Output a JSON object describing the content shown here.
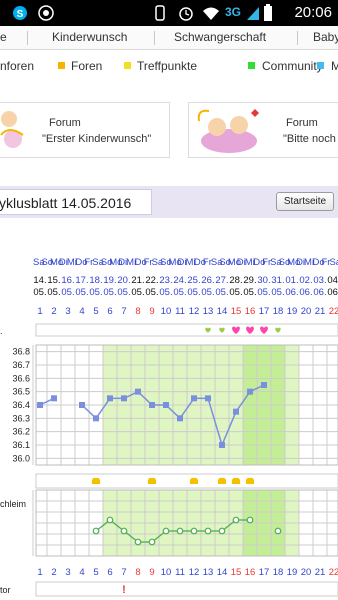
{
  "statusbar": {
    "time": "20:06",
    "network": "3G",
    "icons": [
      "skype-icon",
      "whatsapp-icon",
      "rotation-icon",
      "alarm-icon",
      "wifi-icon",
      "signal-icon",
      "battery-icon"
    ]
  },
  "nav": {
    "items": [
      "e",
      "Kinderwunsch",
      "Schwangerschaft",
      "Baby"
    ]
  },
  "categories": [
    {
      "label": "nforen",
      "color": ""
    },
    {
      "label": "Foren",
      "color": "#f5b400"
    },
    {
      "label": "Treffpunkte",
      "color": "#f0e020"
    },
    {
      "label": "Community",
      "color": "#33dd33"
    },
    {
      "label": "M",
      "color": "#44bbee"
    }
  ],
  "forums": [
    {
      "title": "Forum",
      "name": "\"Erster Kinderwunsch\""
    },
    {
      "title": "Forum",
      "name": "\"Bitte noch"
    }
  ],
  "cycle_sheet": {
    "title": "yklusblatt 14.05.2016",
    "start_button": "Startseite"
  },
  "calendar": {
    "days": [
      "Sa",
      "So",
      "Mo",
      "Di",
      "Mi",
      "Do",
      "Fr",
      "Sa",
      "So",
      "Mo",
      "Di",
      "Mi",
      "Do",
      "Fr",
      "Sa",
      "So",
      "Mo",
      "Di",
      "Mi",
      "Do",
      "Fr",
      "Sa",
      "So",
      "Mo",
      "Di",
      "Mi",
      "Do",
      "Fr",
      "Sa",
      "So",
      "Mo",
      "Di",
      "Mi",
      "Do",
      "Fr",
      "Sa"
    ],
    "dates": [
      "14.",
      "15.",
      "16.",
      "17.",
      "18.",
      "19.",
      "20.",
      "21.",
      "22.",
      "23.",
      "24.",
      "25.",
      "26.",
      "27.",
      "28.",
      "29.",
      "30.",
      "31.",
      "01.",
      "02.",
      "03.",
      "04."
    ],
    "months": [
      "05.",
      "05.",
      "05.",
      "05.",
      "05.",
      "05.",
      "05.",
      "05.",
      "05.",
      "05.",
      "05.",
      "05.",
      "05.",
      "05.",
      "05.",
      "05.",
      "05.",
      "05.",
      "06.",
      "06.",
      "06.",
      "06."
    ],
    "cycle_days": [
      "1",
      "2",
      "3",
      "4",
      "5",
      "6",
      "7",
      "8",
      "9",
      "10",
      "11",
      "12",
      "13",
      "14",
      "15",
      "16",
      "17",
      "18",
      "19",
      "20",
      "21",
      "22"
    ]
  },
  "labels": {
    "temp_axis": [
      "36.8",
      "36.7",
      "36.6",
      "36.5",
      "36.4",
      "36.3",
      "36.2",
      "36.1",
      "36.0"
    ],
    "cervix": "chleim",
    "bottom": "tor",
    "row_mark": "!"
  },
  "chart_data": {
    "type": "line",
    "title": "",
    "xlabel": "",
    "ylabel": "",
    "ylim": [
      35.95,
      36.85
    ],
    "temperature": [
      {
        "day": 1,
        "value": 36.4
      },
      {
        "day": 2,
        "value": 36.45
      },
      {
        "day": 4,
        "value": 36.4
      },
      {
        "day": 5,
        "value": 36.3
      },
      {
        "day": 6,
        "value": 36.45
      },
      {
        "day": 7,
        "value": 36.45
      },
      {
        "day": 8,
        "value": 36.5
      },
      {
        "day": 9,
        "value": 36.4
      },
      {
        "day": 10,
        "value": 36.4
      },
      {
        "day": 11,
        "value": 36.3
      },
      {
        "day": 12,
        "value": 36.45
      },
      {
        "day": 13,
        "value": 36.45
      },
      {
        "day": 14,
        "value": 36.1
      },
      {
        "day": 15,
        "value": 36.35
      },
      {
        "day": 16,
        "value": 36.5
      },
      {
        "day": 17,
        "value": 36.55
      }
    ],
    "fertile_window_days": [
      6,
      19
    ],
    "peak_days": [
      16,
      18
    ],
    "hearts": [
      {
        "day": 13,
        "type": "green"
      },
      {
        "day": 14,
        "type": "green"
      },
      {
        "day": 15,
        "type": "pink"
      },
      {
        "day": 16,
        "type": "pink"
      },
      {
        "day": 17,
        "type": "pink"
      },
      {
        "day": 18,
        "type": "green"
      }
    ],
    "lh_marks_days": [
      5,
      9,
      12,
      14,
      15,
      16
    ],
    "mucus": [
      {
        "day": 5,
        "level": 1
      },
      {
        "day": 6,
        "level": 2
      },
      {
        "day": 7,
        "level": 1
      },
      {
        "day": 8,
        "level": 0
      },
      {
        "day": 9,
        "level": 0
      },
      {
        "day": 10,
        "level": 1
      },
      {
        "day": 11,
        "level": 1
      },
      {
        "day": 12,
        "level": 1
      },
      {
        "day": 13,
        "level": 1
      },
      {
        "day": 14,
        "level": 1
      },
      {
        "day": 15,
        "level": 2
      },
      {
        "day": 16,
        "level": 2
      }
    ],
    "mucus_extra_day": 18,
    "colors": {
      "line": "#7b8fe0",
      "mucus": "#4caf50",
      "fertile": "#e0f6c2",
      "peak": "#c4ee96",
      "red_days": "#e53935",
      "blue_days": "#3344cc"
    }
  }
}
